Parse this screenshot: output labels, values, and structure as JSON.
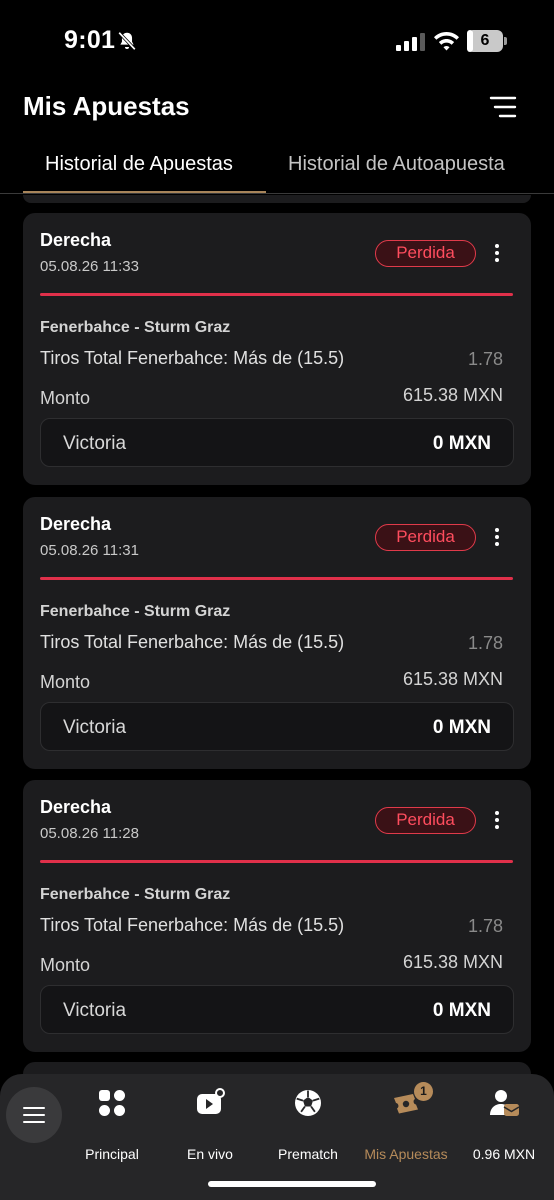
{
  "status_bar": {
    "time": "9:01",
    "battery_level": "6"
  },
  "header": {
    "title": "Mis Apuestas"
  },
  "tabs": [
    {
      "label": "Historial de Apuestas",
      "active": true
    },
    {
      "label": "Historial de Autoapuesta",
      "active": false
    }
  ],
  "bets": [
    {
      "title": "Derecha",
      "date": "05.08.26 11:33",
      "status": "Perdida",
      "match": "Fenerbahce - Sturm Graz",
      "market": "Tiros Total Fenerbahce: Más de (15.5)",
      "odds": "1.78",
      "amount_label": "Monto",
      "amount": "615.38 MXN",
      "win_label": "Victoria",
      "win_value": "0 MXN"
    },
    {
      "title": "Derecha",
      "date": "05.08.26 11:31",
      "status": "Perdida",
      "match": "Fenerbahce - Sturm Graz",
      "market": "Tiros Total Fenerbahce: Más de (15.5)",
      "odds": "1.78",
      "amount_label": "Monto",
      "amount": "615.38 MXN",
      "win_label": "Victoria",
      "win_value": "0 MXN"
    },
    {
      "title": "Derecha",
      "date": "05.08.26 11:28",
      "status": "Perdida",
      "match": "Fenerbahce - Sturm Graz",
      "market": "Tiros Total Fenerbahce: Más de (15.5)",
      "odds": "1.78",
      "amount_label": "Monto",
      "amount": "615.38 MXN",
      "win_label": "Victoria",
      "win_value": "0 MXN"
    }
  ],
  "bottom_nav": {
    "items": [
      {
        "label": "Principal",
        "icon": "grid-icon"
      },
      {
        "label": "En vivo",
        "icon": "live-tv-icon"
      },
      {
        "label": "Prematch",
        "icon": "soccer-ball-icon"
      },
      {
        "label": "Mis Apuestas",
        "icon": "ticket-icon",
        "active": true,
        "badge": "1"
      },
      {
        "label": "0.96 MXN",
        "icon": "account-wallet-icon"
      }
    ]
  },
  "colors": {
    "accent": "#b68b5a",
    "lost": "#e0304a",
    "card": "#1c1c1e",
    "background": "#000000"
  }
}
